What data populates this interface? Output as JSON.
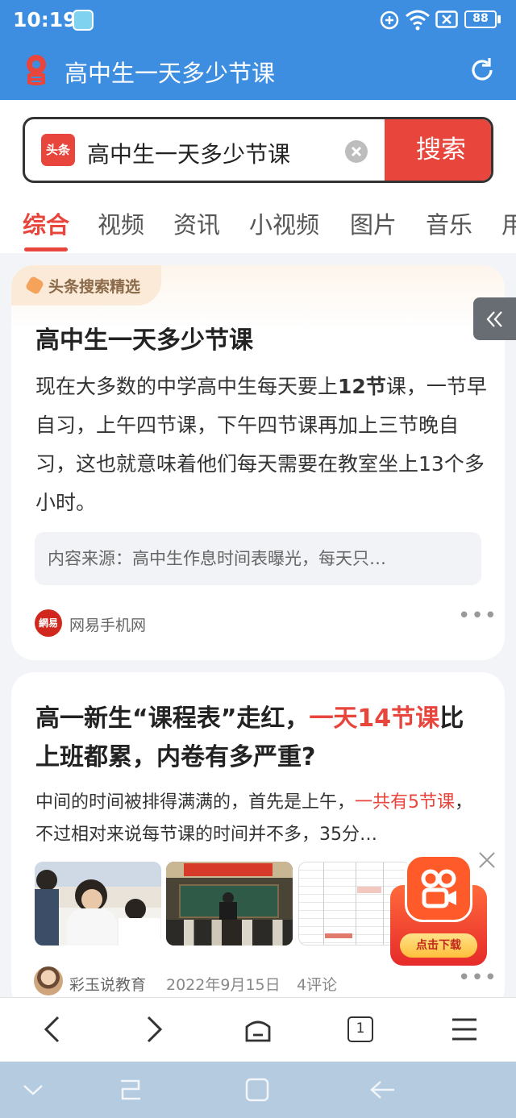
{
  "status_bar": {
    "time": "10:19",
    "battery": "88"
  },
  "title_bar": {
    "title": "高中生一天多少节课"
  },
  "search": {
    "logo_text": "头条",
    "query": "高中生一天多少节课",
    "button_label": "搜索"
  },
  "tabs": [
    "综合",
    "视频",
    "资讯",
    "小视频",
    "图片",
    "音乐",
    "用"
  ],
  "card1": {
    "badge": "头条搜索精选",
    "title": "高中生一天多少节课",
    "body_prefix": "现在大多数的中学高中生每天要上",
    "body_bold": "12节",
    "body_suffix": "课，一节早自习，上午四节课，下午四节课再加上三节晚自习，这也就意味着他们每天需要在教室坐上13个多小时。",
    "source_box": "内容来源：高中生作息时间表曝光，每天只…",
    "site_logo": "網易",
    "site_name": "网易手机网"
  },
  "card2": {
    "title_part1": "高一新生“课程表”走红，",
    "title_highlight": "一天14节课",
    "title_part2": "比上班都累，内卷有多严重?",
    "body_part1": "中间的时间被排得满满的，首先是上午，",
    "body_highlight": "一共有5节课",
    "body_part2": "，不过相对来说每节课的时间并不多，35分…",
    "author": "彩玉说教育",
    "date": "2022年9月15日",
    "comments": "4评论"
  },
  "promo": {
    "label": "点击下载"
  },
  "bottom_nav": {
    "tab_count": "1"
  },
  "colors": {
    "primary_blue": "#3d8ee0",
    "accent_red": "#e8453c"
  }
}
